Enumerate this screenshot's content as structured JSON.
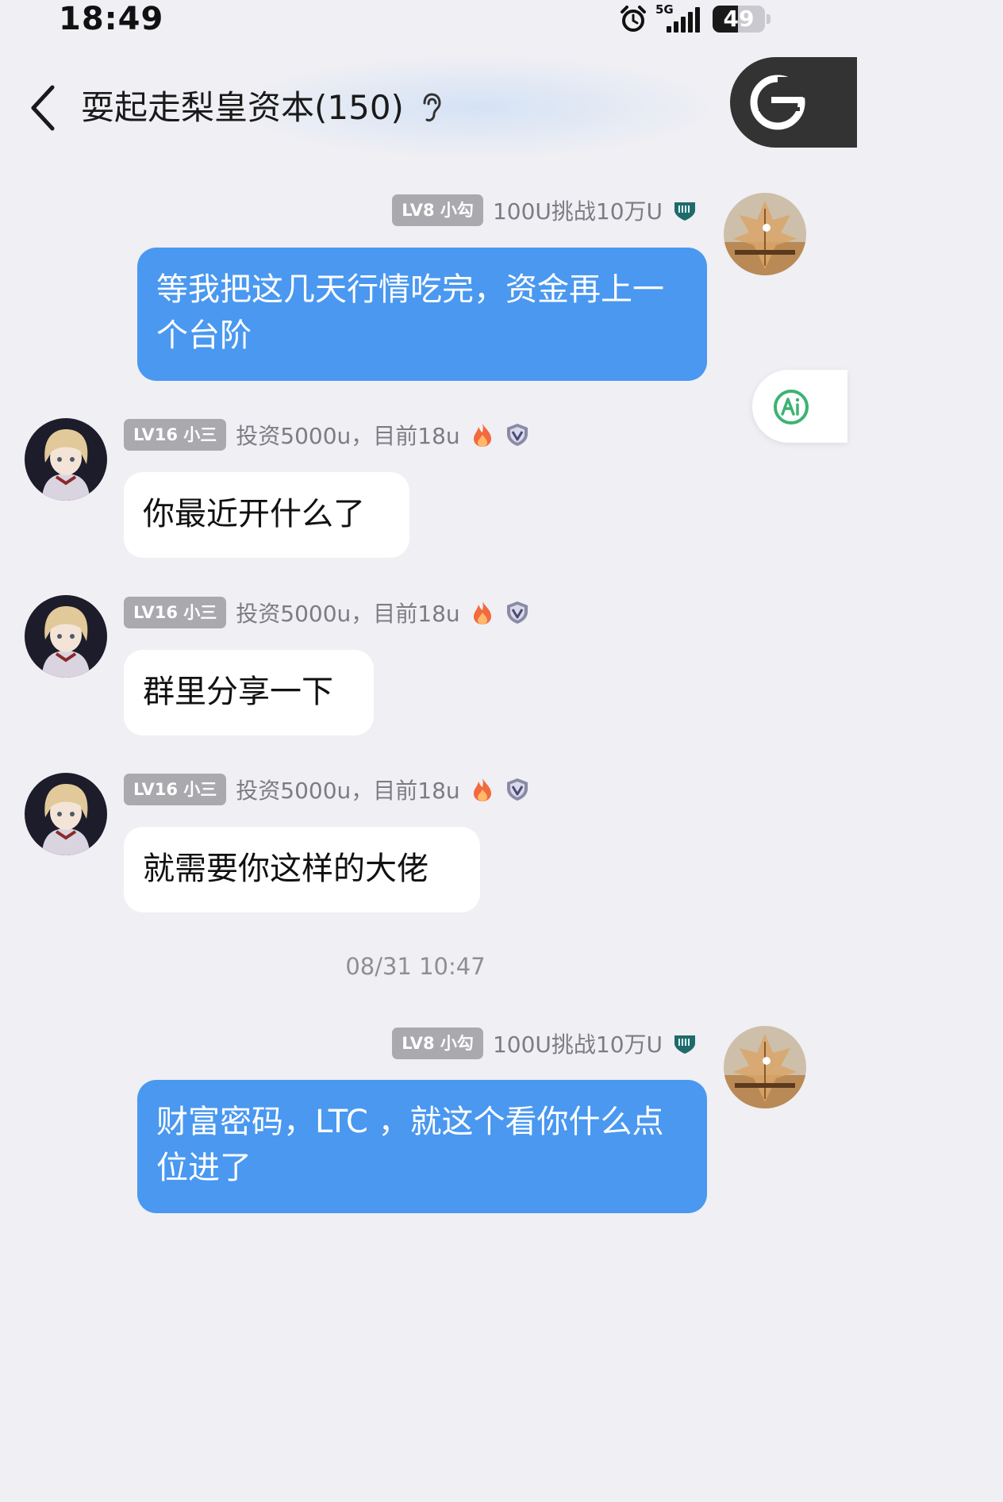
{
  "status_bar": {
    "time": "18:49",
    "network": "5G",
    "battery": "49"
  },
  "header": {
    "title": "耍起走梨皇资本(150)"
  },
  "timestamp": "08/31 10:47",
  "messages": [
    {
      "direction": "out",
      "badge": "LV8 小勾",
      "nickname": "100U挑战10万U",
      "text": "等我把这几天行情吃完，资金再上一个台阶"
    },
    {
      "direction": "in",
      "badge": "LV16 小三",
      "nickname": "投资5000u，目前18u",
      "text": "你最近开什么了"
    },
    {
      "direction": "in",
      "badge": "LV16 小三",
      "nickname": "投资5000u，目前18u",
      "text": "群里分享一下"
    },
    {
      "direction": "in",
      "badge": "LV16 小三",
      "nickname": "投资5000u，目前18u",
      "text": "就需要你这样的大佬"
    },
    {
      "direction": "out",
      "badge": "LV8 小勾",
      "nickname": "100U挑战10万U",
      "text": "财富密码，LTC ，就这个看你什么点位进了"
    }
  ],
  "colors": {
    "background": "#efeff4",
    "outgoing_bubble": "#4a98f0",
    "incoming_bubble": "#ffffff",
    "badge": "#a9a9ae",
    "ai_green": "#3cb371"
  },
  "icons": [
    "back-icon",
    "ear-icon",
    "floating-app-icon",
    "ai-icon",
    "alarm-icon",
    "signal-icon",
    "battery-icon",
    "level-emblem-icon",
    "fire-icon",
    "vip-shield-icon"
  ]
}
